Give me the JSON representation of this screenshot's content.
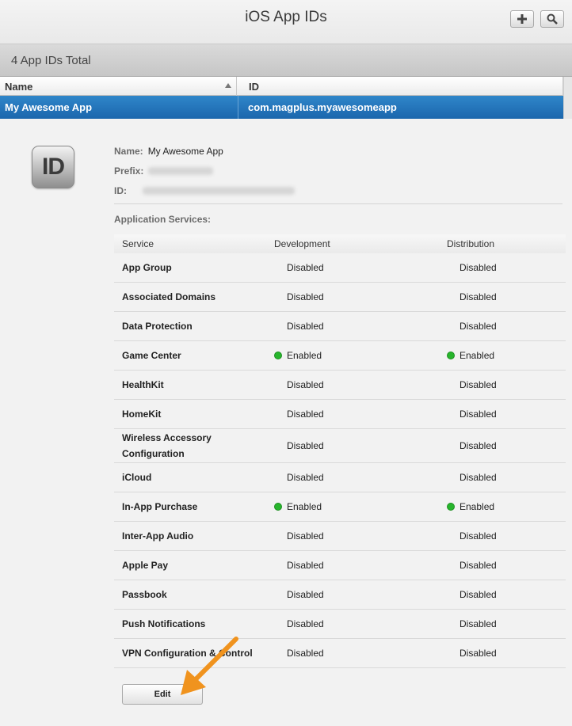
{
  "header": {
    "title": "iOS App IDs",
    "add_icon": "plus-icon",
    "search_icon": "search-icon"
  },
  "countbar": {
    "text": "4 App IDs Total"
  },
  "list": {
    "columns": [
      "Name",
      "ID"
    ],
    "selected_row": {
      "name": "My Awesome App",
      "id": "com.magplus.myawesomeapp"
    }
  },
  "detail": {
    "icon_text": "ID",
    "name_label": "Name:",
    "name_value": "My Awesome App",
    "prefix_label": "Prefix:",
    "id_label": "ID:",
    "services_label": "Application Services:",
    "table_headers": {
      "service": "Service",
      "development": "Development",
      "distribution": "Distribution"
    },
    "services": [
      {
        "name": "App Group",
        "dev": "Disabled",
        "dist": "Disabled"
      },
      {
        "name": "Associated Domains",
        "dev": "Disabled",
        "dist": "Disabled"
      },
      {
        "name": "Data Protection",
        "dev": "Disabled",
        "dist": "Disabled"
      },
      {
        "name": "Game Center",
        "dev": "Enabled",
        "dist": "Enabled"
      },
      {
        "name": "HealthKit",
        "dev": "Disabled",
        "dist": "Disabled"
      },
      {
        "name": "HomeKit",
        "dev": "Disabled",
        "dist": "Disabled"
      },
      {
        "name": "Wireless Accessory Configuration",
        "dev": "Disabled",
        "dist": "Disabled"
      },
      {
        "name": "iCloud",
        "dev": "Disabled",
        "dist": "Disabled"
      },
      {
        "name": "In-App Purchase",
        "dev": "Enabled",
        "dist": "Enabled"
      },
      {
        "name": "Inter-App Audio",
        "dev": "Disabled",
        "dist": "Disabled"
      },
      {
        "name": "Apple Pay",
        "dev": "Disabled",
        "dist": "Disabled"
      },
      {
        "name": "Passbook",
        "dev": "Disabled",
        "dist": "Disabled"
      },
      {
        "name": "Push Notifications",
        "dev": "Disabled",
        "dist": "Disabled"
      },
      {
        "name": "VPN Configuration & Control",
        "dev": "Disabled",
        "dist": "Disabled"
      }
    ],
    "edit_label": "Edit"
  },
  "colors": {
    "selection": "#1f6fb6",
    "enabled_dot": "#27b52c",
    "annotation_arrow": "#f0931e"
  }
}
